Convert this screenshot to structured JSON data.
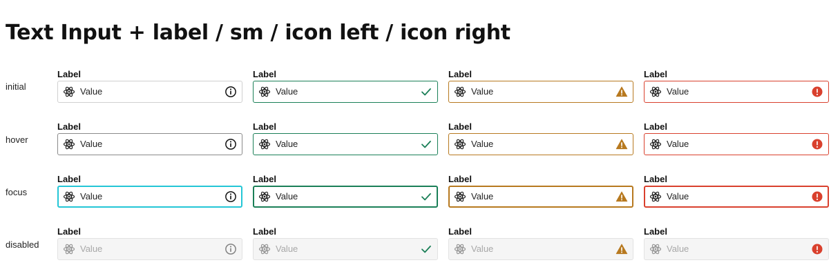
{
  "title": "Text Input + label / sm / icon left / icon right",
  "field_label": "Label",
  "field_value": "Value",
  "icons": {
    "left": "atom-icon",
    "default": "info-icon",
    "success": "check-icon",
    "warning": "warning-icon",
    "error": "error-icon"
  },
  "colors": {
    "default_border": "#d0d0d0",
    "hover_border": "#8a8a8a",
    "focus_border": "#24c6d6",
    "success": "#1a7f57",
    "warning": "#b7791f",
    "error": "#d9402d",
    "disabled_bg": "#f5f5f5",
    "disabled_text": "#a8a8a8"
  },
  "variants": [
    "default",
    "success",
    "warning",
    "error"
  ],
  "states": [
    {
      "key": "initial",
      "label": "initial"
    },
    {
      "key": "hover",
      "label": "hover"
    },
    {
      "key": "focus",
      "label": "focus"
    },
    {
      "key": "disabled",
      "label": "disabled"
    }
  ]
}
